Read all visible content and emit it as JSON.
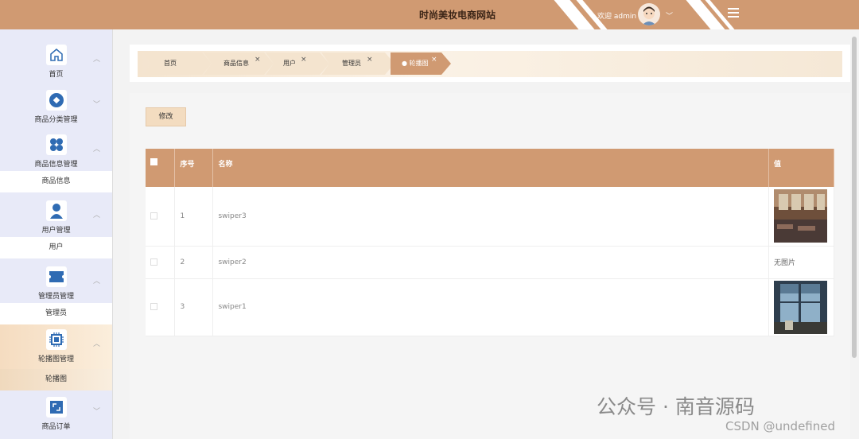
{
  "header": {
    "title": "时尚美妆电商网站",
    "welcome": "欢迎 admin",
    "user_icon": "avatar",
    "menu_icon": "menu-toggle-icon"
  },
  "colors": {
    "accent": "#d09a72",
    "sidebar_bg": "#e8eaf8",
    "active_tab": "#d09a72"
  },
  "sidebar": {
    "items": [
      {
        "label": "首页",
        "icon": "home-icon"
      },
      {
        "label": "商品分类管理",
        "icon": "category-icon"
      },
      {
        "label": "商品信息管理",
        "icon": "grid-icon",
        "sub": "商品信息"
      },
      {
        "label": "用户管理",
        "icon": "user-icon",
        "sub": "用户"
      },
      {
        "label": "管理员管理",
        "icon": "ticket-icon",
        "sub": "管理员"
      },
      {
        "label": "轮播图管理",
        "icon": "chip-icon",
        "sub": "轮播图"
      },
      {
        "label": "商品订单",
        "icon": "image-icon"
      }
    ]
  },
  "tabs": [
    {
      "label": "首页"
    },
    {
      "label": "商品信息",
      "close": "×"
    },
    {
      "label": "用户",
      "close": "×"
    },
    {
      "label": "管理员",
      "close": "×"
    },
    {
      "label": "● 轮播图",
      "close": "×"
    }
  ],
  "toolbar": {
    "edit_label": "修改"
  },
  "table": {
    "columns": [
      "序号",
      "名称",
      "值"
    ],
    "rows": [
      {
        "index": "1",
        "name": "swiper3",
        "value": "image"
      },
      {
        "index": "2",
        "name": "swiper2",
        "value": "无图片"
      },
      {
        "index": "3",
        "name": "swiper1",
        "value": "image"
      }
    ]
  },
  "watermark": {
    "main": "公众号 · 南音源码",
    "sub": "CSDN @undefined"
  }
}
